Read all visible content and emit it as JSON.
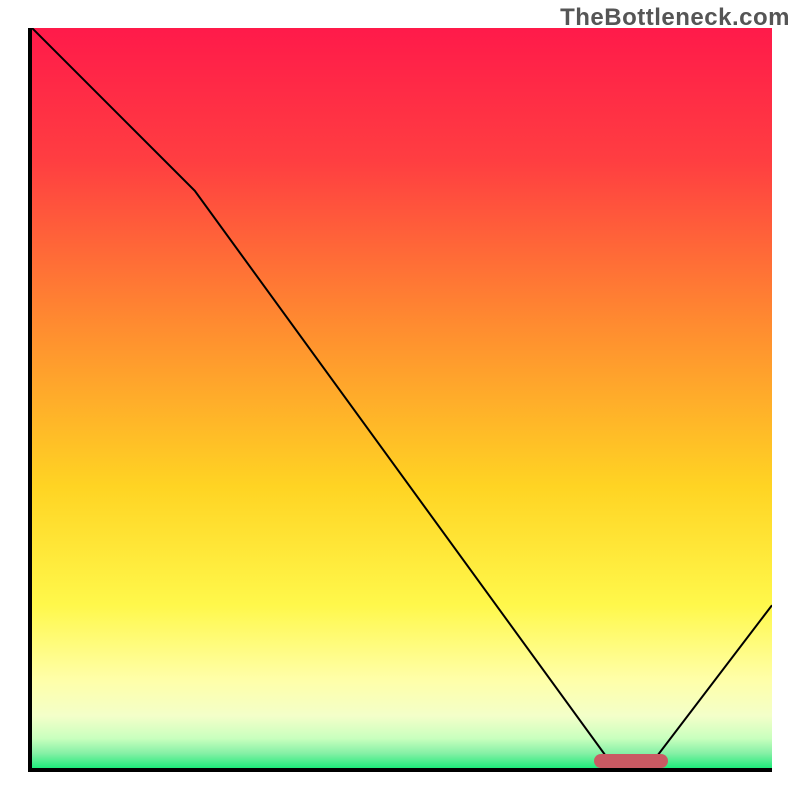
{
  "watermark": "TheBottleneck.com",
  "chart_data": {
    "type": "line",
    "title": "",
    "xlabel": "",
    "ylabel": "",
    "xlim": [
      0,
      100
    ],
    "ylim": [
      0,
      100
    ],
    "x": [
      0,
      22,
      78,
      84,
      100
    ],
    "values": [
      100,
      78,
      1,
      1,
      22
    ],
    "marker": {
      "x_start": 76,
      "x_end": 86,
      "y": 1
    },
    "gradient_stops": [
      {
        "pos": 0,
        "color": "#ff1a4a"
      },
      {
        "pos": 18,
        "color": "#ff3e41"
      },
      {
        "pos": 40,
        "color": "#ff8b30"
      },
      {
        "pos": 62,
        "color": "#ffd423"
      },
      {
        "pos": 78,
        "color": "#fff84b"
      },
      {
        "pos": 88,
        "color": "#ffffa8"
      },
      {
        "pos": 93,
        "color": "#f3ffc9"
      },
      {
        "pos": 96,
        "color": "#c9ffbe"
      },
      {
        "pos": 98,
        "color": "#86f0a6"
      },
      {
        "pos": 100,
        "color": "#1eeb7a"
      }
    ]
  }
}
